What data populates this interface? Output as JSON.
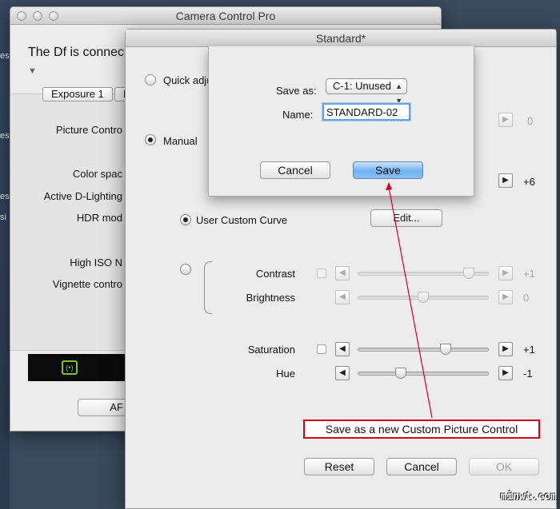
{
  "desktop": {
    "glyphs": [
      "es",
      "es",
      "es",
      "si"
    ]
  },
  "back_window": {
    "title": "Camera Control Pro",
    "headline": "The Df is connec",
    "disclosure": "▼",
    "tabs": [
      "Exposure 1",
      "E"
    ],
    "labels": [
      "Picture Contro",
      "Color spac",
      "Active D-Lighting",
      "HDR mod",
      "High ISO N",
      "Vignette contro"
    ],
    "af_icon": "(•)",
    "button_label": "AF"
  },
  "main_window": {
    "title": "Standard*",
    "quick_adjust_label": "Quick adju",
    "manual_label": "Manual",
    "right_values": [
      "0",
      "+6"
    ],
    "user_curve_label": "User Custom Curve",
    "edit_button": "Edit...",
    "sliders": [
      {
        "label": "Contrast",
        "value": "+1",
        "level": 0.85,
        "enabled": false,
        "has_check": true
      },
      {
        "label": "Brightness",
        "value": "0",
        "level": 0.5,
        "enabled": false,
        "has_check": false
      },
      {
        "label": "Saturation",
        "value": "+1",
        "level": 0.67,
        "enabled": true,
        "has_check": true
      },
      {
        "label": "Hue",
        "value": "-1",
        "level": 0.33,
        "enabled": true,
        "has_check": false
      }
    ],
    "annotation": "Save as a new Custom Picture Control",
    "buttons": {
      "reset": "Reset",
      "cancel": "Cancel",
      "ok": "OK"
    }
  },
  "sheet": {
    "save_as_label": "Save as:",
    "save_as_value": "C-1: Unused",
    "name_label": "Name:",
    "name_value": "STANDARD-02",
    "cancel_button": "Cancel",
    "save_button": "Save"
  },
  "watermark": "minwt.com",
  "colors": {
    "annotation_red": "#d6001c",
    "focus_blue": "#6aa3e0",
    "primary_button": "#6fb1f2"
  }
}
